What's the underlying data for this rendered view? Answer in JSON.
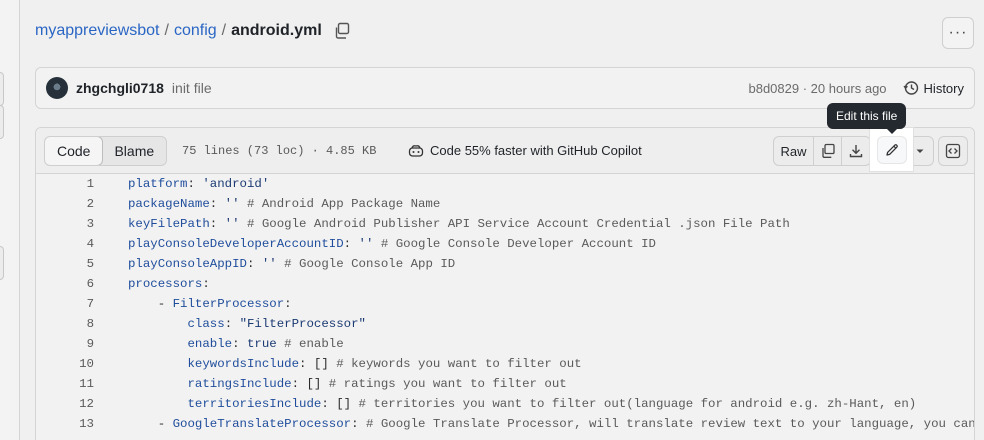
{
  "breadcrumb": {
    "repo": "myappreviewsbot",
    "sep1": "/",
    "folder": "config",
    "sep2": "/",
    "file": "android.yml"
  },
  "more_label": "···",
  "commit": {
    "author": "zhgchgli0718",
    "message": "init file",
    "hash_time": "b8d0829 · 20 hours ago",
    "history_label": "History"
  },
  "toolbar": {
    "code_tab": "Code",
    "blame_tab": "Blame",
    "meta": "75 lines (73 loc) · 4.85 KB",
    "copilot": "Code 55% faster with GitHub Copilot",
    "raw_label": "Raw",
    "tooltip": "Edit this file"
  },
  "code_lines": [
    {
      "n": "1",
      "key": "platform",
      "rest": ": ",
      "str": "'android'",
      "comment": ""
    },
    {
      "n": "2",
      "key": "packageName",
      "rest": ": ",
      "str": "''",
      "comment": " # Android App Package Name"
    },
    {
      "n": "3",
      "key": "keyFilePath",
      "rest": ": ",
      "str": "''",
      "comment": " # Google Android Publisher API Service Account Credential .json File Path"
    },
    {
      "n": "4",
      "key": "playConsoleDeveloperAccountID",
      "rest": ": ",
      "str": "''",
      "comment": " # Google Console Developer Account ID"
    },
    {
      "n": "5",
      "key": "playConsoleAppID",
      "rest": ": ",
      "str": "''",
      "comment": " # Google Console App ID"
    },
    {
      "n": "6",
      "key": "processors",
      "rest": ":",
      "str": "",
      "comment": ""
    },
    {
      "n": "7",
      "indent": "    - ",
      "key": "FilterProcessor",
      "rest": ":",
      "str": "",
      "comment": ""
    },
    {
      "n": "8",
      "indent": "        ",
      "key": "class",
      "rest": ": ",
      "str": "\"FilterProcessor\"",
      "comment": ""
    },
    {
      "n": "9",
      "indent": "        ",
      "key": "enable",
      "rest": ": ",
      "str": "true",
      "comment": " # enable"
    },
    {
      "n": "10",
      "indent": "        ",
      "key": "keywordsInclude",
      "rest": ": [] ",
      "str": "",
      "comment": "# keywords you want to filter out"
    },
    {
      "n": "11",
      "indent": "        ",
      "key": "ratingsInclude",
      "rest": ": [] ",
      "str": "",
      "comment": "# ratings you want to filter out"
    },
    {
      "n": "12",
      "indent": "        ",
      "key": "territoriesInclude",
      "rest": ": [] ",
      "str": "",
      "comment": "# territories you want to filter out(language for android e.g. zh-Hant, en)"
    },
    {
      "n": "13",
      "indent": "    - ",
      "key": "GoogleTranslateProcessor",
      "rest": ": ",
      "str": "",
      "comment": "# Google Translate Processor, will translate review text to your language, you can re"
    }
  ]
}
